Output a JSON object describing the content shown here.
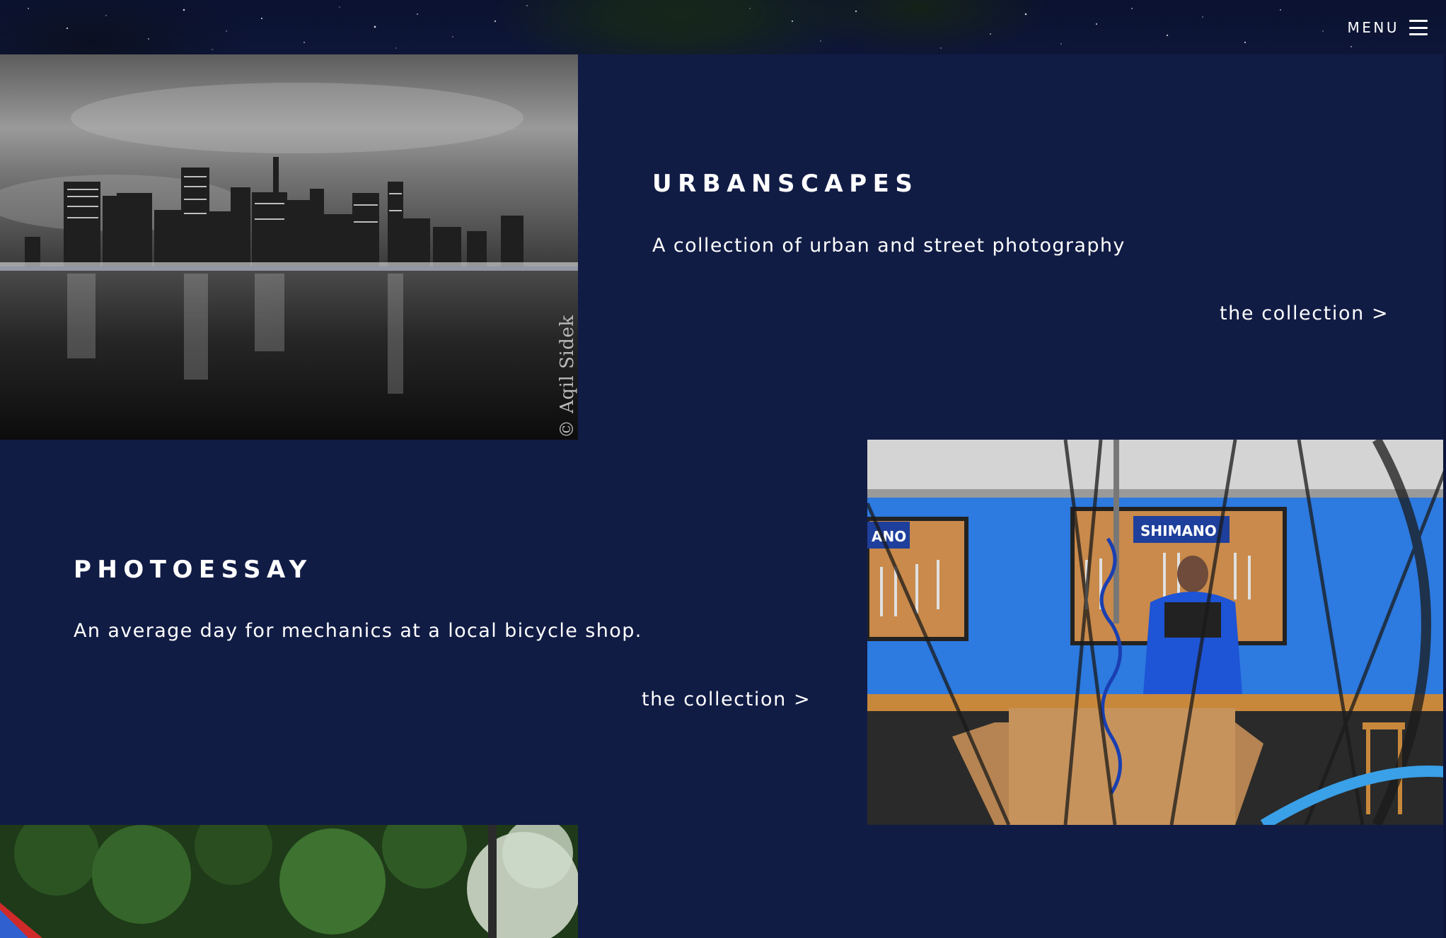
{
  "header": {
    "menu_label": "MENU"
  },
  "sections": [
    {
      "title": "URBANSCAPES",
      "description": "A collection of urban and street photography",
      "link_label": "the collection >",
      "watermark": "© Aqil Sidek"
    },
    {
      "title": "PHOTOESSAY",
      "description": "An average day for mechanics at a local bicycle shop.",
      "link_label": "the collection >",
      "sign_left": "ANO",
      "sign_main": "SHIMANO"
    }
  ],
  "colors": {
    "background": "#111c45",
    "text": "#ffffff",
    "shop_wall": "#2d7ae0"
  }
}
